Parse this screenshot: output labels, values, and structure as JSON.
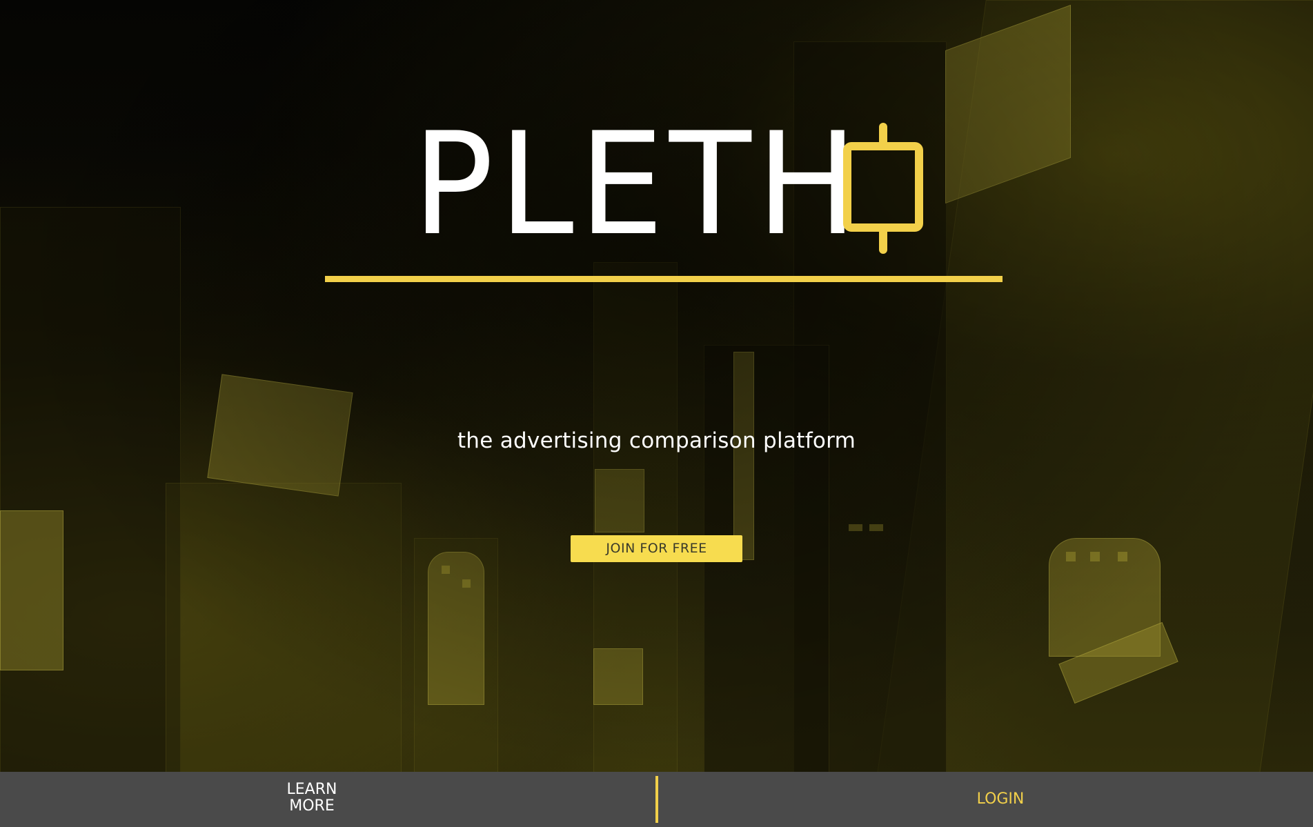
{
  "brand": {
    "logo_text": "PLETH",
    "logo_mark_icon": "candlestick-o-icon",
    "accent_color": "#f2d04a"
  },
  "hero": {
    "tagline": "the advertising comparison platform",
    "cta_label": "JOIN FOR FREE"
  },
  "footer": {
    "learn_more_line1": "LEARN",
    "learn_more_line2": "MORE",
    "login_label": "LOGIN"
  }
}
